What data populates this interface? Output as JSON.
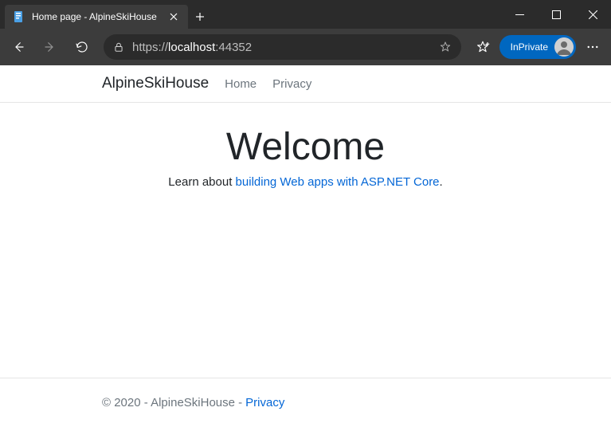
{
  "window": {
    "minimize": "—",
    "maximize": "▢",
    "close": "✕"
  },
  "tab": {
    "title": "Home page - AlpineSkiHouse"
  },
  "url": {
    "scheme": "https://",
    "host": "localhost",
    "port": ":44352"
  },
  "inprivate": {
    "label": "InPrivate"
  },
  "site": {
    "brand": "AlpineSkiHouse",
    "nav": {
      "home": "Home",
      "privacy": "Privacy"
    },
    "hero": {
      "title": "Welcome",
      "lead_prefix": "Learn about ",
      "lead_link": "building Web apps with ASP.NET Core",
      "lead_suffix": "."
    },
    "footer": {
      "text": "© 2020 - AlpineSkiHouse - ",
      "privacy": "Privacy"
    }
  }
}
